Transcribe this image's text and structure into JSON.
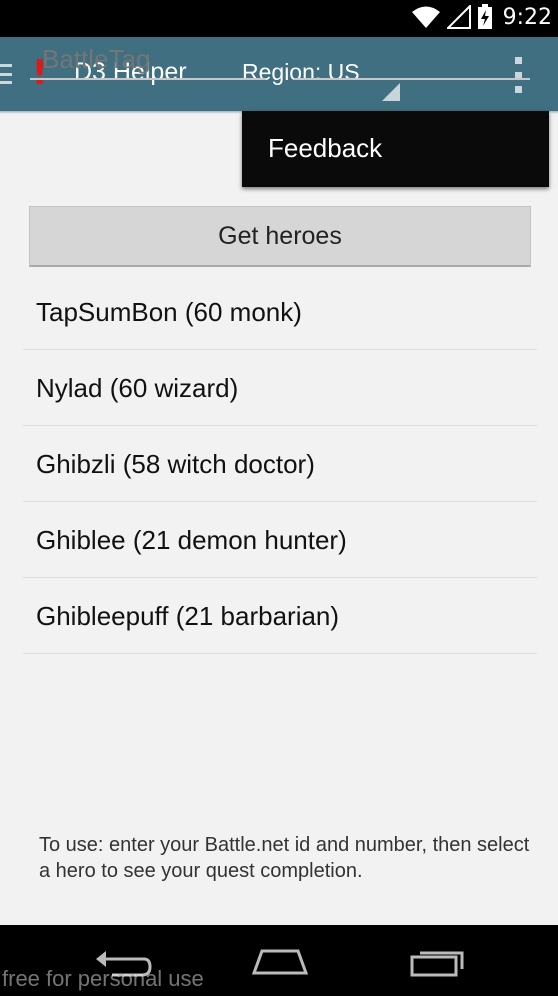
{
  "status_bar": {
    "time": "9:22",
    "icons": [
      "wifi-icon",
      "signal-icon",
      "battery-charging-icon"
    ]
  },
  "action_bar": {
    "title": "D3 Helper",
    "region_label": "Region: US",
    "icons": [
      "drawer-icon",
      "alert-icon",
      "overflow-menu-icon"
    ],
    "alert_color": "#e01818",
    "background_color": "#3f6f80"
  },
  "form": {
    "battletag_placeholder": "BattleTag",
    "number_placeholder": "",
    "get_heroes_label": "Get heroes"
  },
  "heroes": [
    "TapSumBon (60 monk)",
    "Nylad (60 wizard)",
    "Ghibzli (58 witch doctor)",
    "Ghiblee (21 demon hunter)",
    "Ghibleepuff (21 barbarian)"
  ],
  "instructions": "To use: enter your Battle.net id and number, then select a hero to see your quest completion.",
  "overflow_menu": {
    "items": [
      "Feedback"
    ]
  },
  "nav_bar": {
    "icons": [
      "back-icon",
      "home-icon",
      "recents-icon"
    ]
  },
  "watermark": "free for personal use"
}
